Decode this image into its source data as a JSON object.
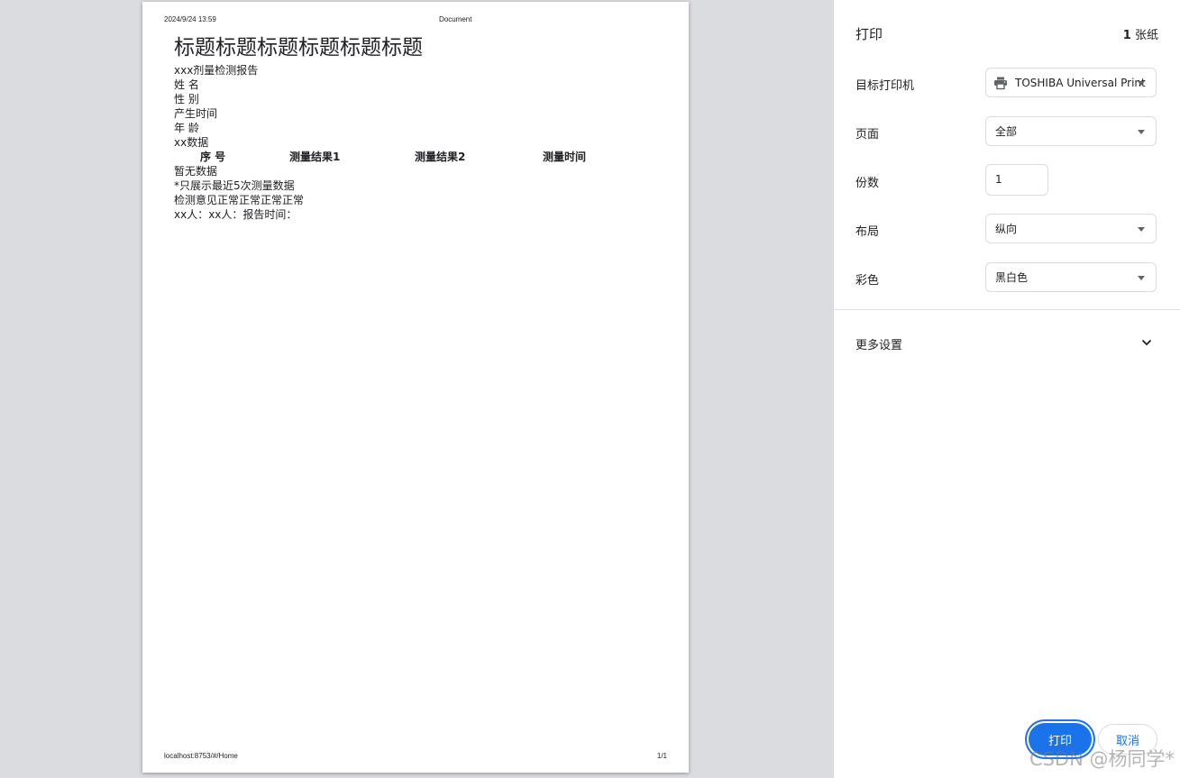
{
  "document": {
    "header_date": "2024/9/24 13:59",
    "header_title": "Document",
    "footer_url": "localhost:8753/#/Home",
    "footer_page": "1/1",
    "heading": "标题标题标题标题标题标题",
    "lines_top": [
      "xxx剂量检测报告",
      "姓 名",
      "性 别",
      "产生时间",
      "年 龄",
      "xx数据"
    ],
    "table_headers": [
      "序 号",
      "测量结果1",
      "测量结果2",
      "测量时间"
    ],
    "lines_bottom": [
      "暂无数据",
      "*只展示最近5次测量数据",
      "检测意见正常正常正常正常",
      "xx人：xx人：报告时间："
    ]
  },
  "panel": {
    "title": "打印",
    "sheet_count_number": "1",
    "sheet_count_unit": "张纸",
    "destination_label": "目标打印机",
    "destination_value": "TOSHIBA Universal Print",
    "pages_label": "页面",
    "pages_value": "全部",
    "copies_label": "份数",
    "copies_value": "1",
    "layout_label": "布局",
    "layout_value": "纵向",
    "color_label": "彩色",
    "color_value": "黑白色",
    "more_settings_label": "更多设置",
    "print_label": "打印",
    "cancel_label": "取消"
  },
  "watermark": "CSDN @杨同学*",
  "colors": {
    "accent": "#1a73e8",
    "background": "#dadce0"
  },
  "icons": {
    "printer": "printer-icon",
    "more": "chevron-down-icon"
  }
}
